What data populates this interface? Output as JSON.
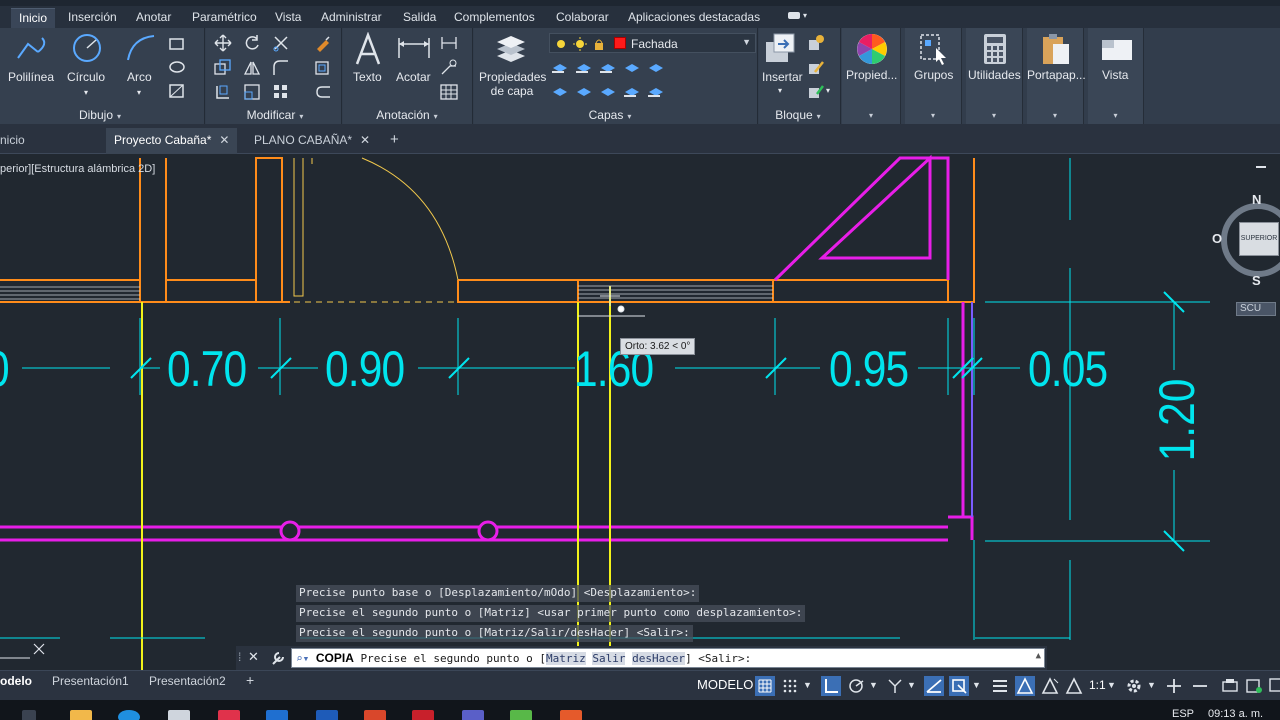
{
  "ribbon_tabs": [
    "Inicio",
    "Inserción",
    "Anotar",
    "Paramétrico",
    "Vista",
    "Administrar",
    "Salida",
    "Complementos",
    "Colaborar",
    "Aplicaciones destacadas"
  ],
  "draw_panel": {
    "polyline": "Polilínea",
    "circle": "Círculo",
    "arc": "Arco",
    "title": "Dibujo"
  },
  "modify_panel": {
    "title": "Modificar"
  },
  "annotation_panel": {
    "text": "Texto",
    "dimension": "Acotar",
    "title": "Anotación"
  },
  "layers_panel": {
    "properties_line1": "Propiedades",
    "properties_line2": "de capa",
    "current_layer": "Fachada",
    "current_layer_color": "#ff1a1a",
    "title": "Capas"
  },
  "block_panel": {
    "insert": "Insertar",
    "title": "Bloque"
  },
  "big_buttons": {
    "properties": "Propied...",
    "groups": "Grupos",
    "utilities": "Utilidades",
    "clipboard": "Portapap...",
    "view": "Vista"
  },
  "doc_tabs": {
    "start": "nicio",
    "project": "Proyecto Cabaña*",
    "plan": "PLANO CABAÑA*"
  },
  "viewport_label": "perior][Estructura alámbrica 2D]",
  "viewcube": {
    "north": "N",
    "south": "S",
    "west": "O",
    "face": "SUPERIOR",
    "ucs": "SCU"
  },
  "dimensions": {
    "d0": "0",
    "d1": "0.70",
    "d2": "0.90",
    "d3": "1.60",
    "d4": "0.95",
    "d5": "0.05",
    "vertical": "1.20"
  },
  "ortho_tooltip": "Orto: 3.62 < 0°",
  "command_history": [
    "Precise punto base o [Desplazamiento/mOdo] <Desplazamiento>:",
    "Precise el segundo punto o [Matriz] <usar primer punto como desplazamiento>:",
    "Precise el segundo punto o [Matriz/Salir/desHacer] <Salir>:"
  ],
  "command_line": {
    "name": "COPIA",
    "prefix": "Precise el segundo punto o [",
    "opt1": "Matriz",
    "opt2": "Salir",
    "opt3": "desHacer",
    "suffix": "] <Salir>:"
  },
  "layout_tabs": {
    "model": "odelo",
    "layout1": "Presentación1",
    "layout2": "Presentación2"
  },
  "status_bar": {
    "model_label": "MODELO",
    "scale": "1:1"
  },
  "taskbar": {
    "lang": "ESP",
    "time": "09:13 a. m."
  },
  "colors": {
    "cyan": "#00e5ee",
    "orange": "#ff8c1a",
    "magenta": "#e81ee8",
    "yellow": "#f2f21a"
  }
}
